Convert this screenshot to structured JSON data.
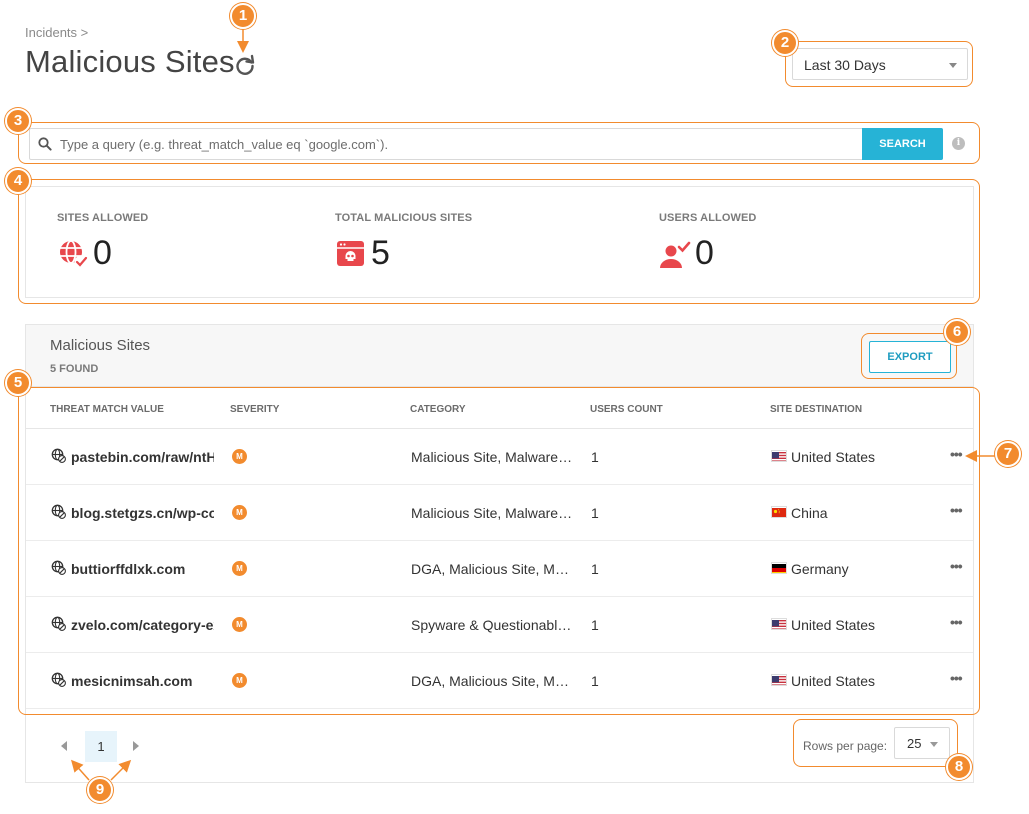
{
  "header": {
    "breadcrumb": "Incidents >",
    "title": "Malicious Sites"
  },
  "date_range": {
    "selected": "Last 30 Days"
  },
  "search": {
    "placeholder": "Type a query (e.g. threat_match_value eq `google.com`).",
    "button_label": "SEARCH",
    "info_glyph": "i"
  },
  "stats": [
    {
      "label": "SITES ALLOWED",
      "value": "0",
      "icon": "globe-check-icon"
    },
    {
      "label": "TOTAL MALICIOUS SITES",
      "value": "5",
      "icon": "malicious-browser-icon"
    },
    {
      "label": "USERS ALLOWED",
      "value": "0",
      "icon": "user-check-icon"
    }
  ],
  "panel": {
    "title": "Malicious Sites",
    "count": "5 FOUND",
    "export_label": "EXPORT"
  },
  "table": {
    "columns": [
      "THREAT MATCH VALUE",
      "SEVERITY",
      "CATEGORY",
      "USERS COUNT",
      "SITE DESTINATION"
    ],
    "rows": [
      {
        "value": "pastebin.com/raw/ntH",
        "severity": "M",
        "category": "Malicious Site, Malware ...",
        "users": "1",
        "destination": "United States",
        "flag": "us"
      },
      {
        "value": "blog.stetgzs.cn/wp-con",
        "severity": "M",
        "category": "Malicious Site, Malware ...",
        "users": "1",
        "destination": "China",
        "flag": "cn"
      },
      {
        "value": "buttiorffdlxk.com",
        "severity": "M",
        "category": "DGA, Malicious Site, Mal...",
        "users": "1",
        "destination": "Germany",
        "flag": "de"
      },
      {
        "value": "zvelo.com/category-ex",
        "severity": "M",
        "category": "Spyware & Questionable...",
        "users": "1",
        "destination": "United States",
        "flag": "us"
      },
      {
        "value": "mesicnimsah.com",
        "severity": "M",
        "category": "DGA, Malicious Site, Mal...",
        "users": "1",
        "destination": "United States",
        "flag": "us"
      }
    ],
    "more_glyph": "•••"
  },
  "pagination": {
    "current_page": "1",
    "rows_per_page_label": "Rows per page:",
    "rows_per_page": "25"
  },
  "callouts": [
    "1",
    "2",
    "3",
    "4",
    "5",
    "6",
    "7",
    "8",
    "9"
  ],
  "colors": {
    "accent": "#26b3d6",
    "callout": "#f28b2e",
    "danger": "#e8474c",
    "severity_medium": "#f28b2e"
  }
}
